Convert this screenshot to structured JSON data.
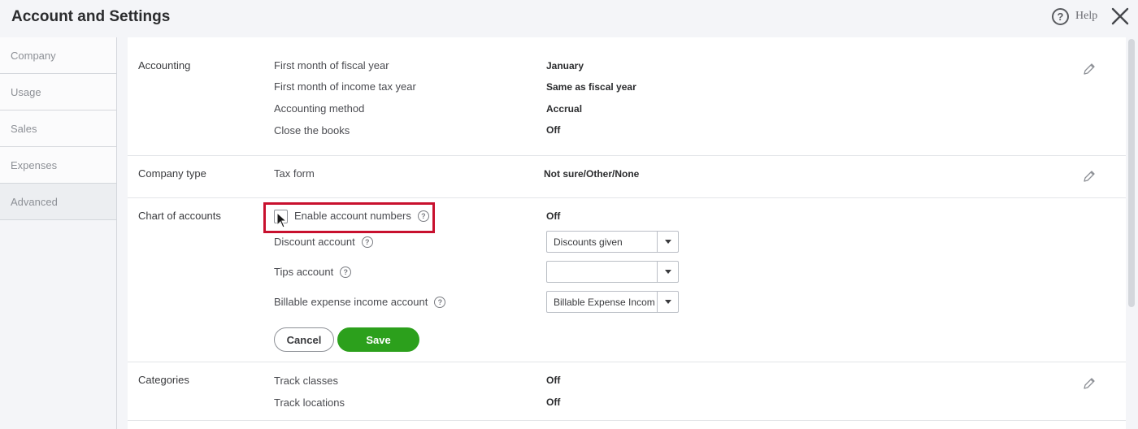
{
  "header": {
    "title": "Account and Settings",
    "help_label": "Help"
  },
  "sidebar": {
    "items": [
      {
        "label": "Company"
      },
      {
        "label": "Usage"
      },
      {
        "label": "Sales"
      },
      {
        "label": "Expenses"
      },
      {
        "label": "Advanced",
        "active": true
      }
    ]
  },
  "accounting": {
    "label": "Accounting",
    "rows": [
      {
        "label": "First month of fiscal year",
        "value": "January"
      },
      {
        "label": "First month of income tax year",
        "value": "Same as fiscal year"
      },
      {
        "label": "Accounting method",
        "value": "Accrual"
      },
      {
        "label": "Close the books",
        "value": "Off"
      }
    ]
  },
  "company_type": {
    "label": "Company type",
    "rows": [
      {
        "label": "Tax form",
        "value": "Not sure/Other/None"
      }
    ]
  },
  "chart_of_accounts": {
    "label": "Chart of accounts",
    "enable_account_numbers": {
      "label": "Enable account numbers",
      "value": "Off",
      "checked": false
    },
    "discount_account": {
      "label": "Discount account",
      "selected": "Discounts given"
    },
    "tips_account": {
      "label": "Tips account",
      "selected": ""
    },
    "billable_expense_income_account": {
      "label": "Billable expense income account",
      "selected": "Billable Expense Incom"
    },
    "cancel_label": "Cancel",
    "save_label": "Save"
  },
  "categories": {
    "label": "Categories",
    "rows": [
      {
        "label": "Track classes",
        "value": "Off"
      },
      {
        "label": "Track locations",
        "value": "Off"
      }
    ]
  },
  "colors": {
    "save_green": "#2ca01c",
    "highlight_red": "#c8102e"
  },
  "icons": [
    "help-icon",
    "close-icon",
    "pencil-icon",
    "question-icon",
    "dropdown-arrow-icon",
    "cursor-icon"
  ]
}
